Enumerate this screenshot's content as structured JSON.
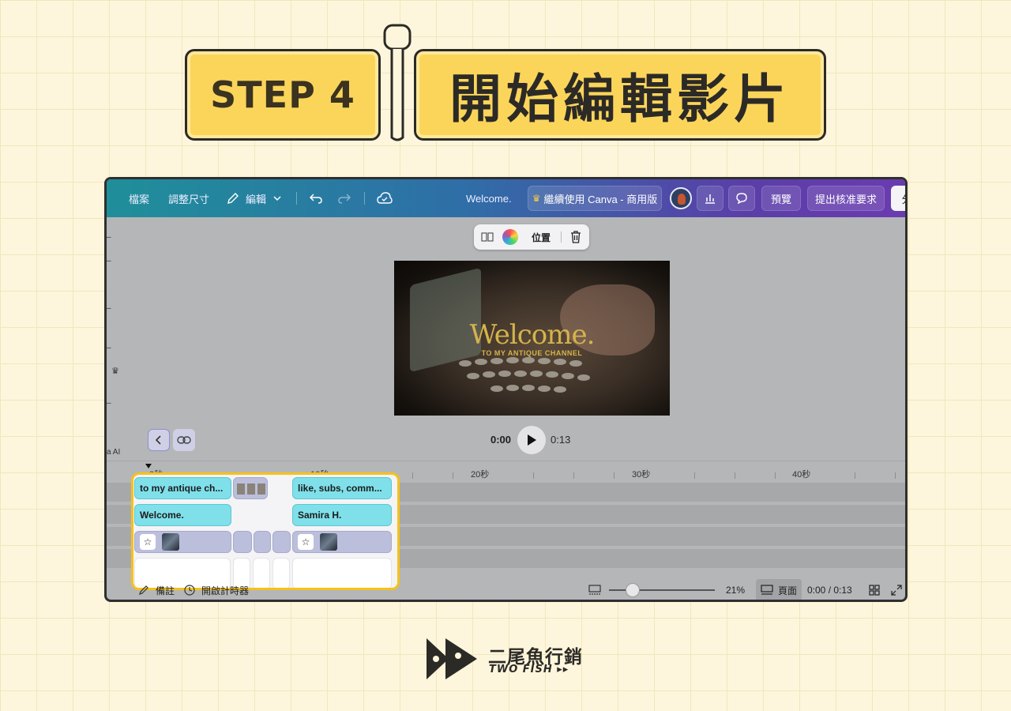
{
  "header": {
    "step_label": "STEP 4",
    "title": "開始編輯影片"
  },
  "topbar": {
    "file_menu": "檔案",
    "resize_menu": "調整尺寸",
    "edit_menu": "編輯",
    "doc_title": "Welcome.",
    "upgrade_button": "繼續使用 Canva - 商用版",
    "preview_button": "預覽",
    "submit_button": "提出核准要求",
    "share_button_partial": "分"
  },
  "left_strip": {
    "ai_label": "a AI"
  },
  "float_toolbar": {
    "position_label": "位置"
  },
  "video": {
    "title_text": "Welcome.",
    "subtitle_text": "TO MY ANTIQUE CHANNEL"
  },
  "playback": {
    "current_time": "0:00",
    "total_time": "0:13"
  },
  "ruler": {
    "labels": [
      "0秒",
      "10秒",
      "20秒",
      "30秒",
      "40秒"
    ]
  },
  "timeline": {
    "text_clips": [
      "to my antique ch...",
      "like, subs, comm...",
      "Welcome.",
      "Samira H."
    ]
  },
  "bottombar": {
    "notes_label": "備註",
    "timer_label": "開啟計時器",
    "zoom_percent": "21%",
    "zoom_level": 0.21,
    "pages_label": "頁面",
    "time_readout": "0:00 / 0:13"
  },
  "footer": {
    "brand_cn": "二尾魚行銷",
    "brand_en": "TWO FISH ▸▸"
  },
  "colors": {
    "banner_yellow": "#fbd55a",
    "background": "#fdf6dc",
    "highlight_border": "#f6c21a",
    "text_clip": "#7fe0ea",
    "video_clip": "#bcbfdb",
    "video_text_gold": "#d4b44a"
  }
}
